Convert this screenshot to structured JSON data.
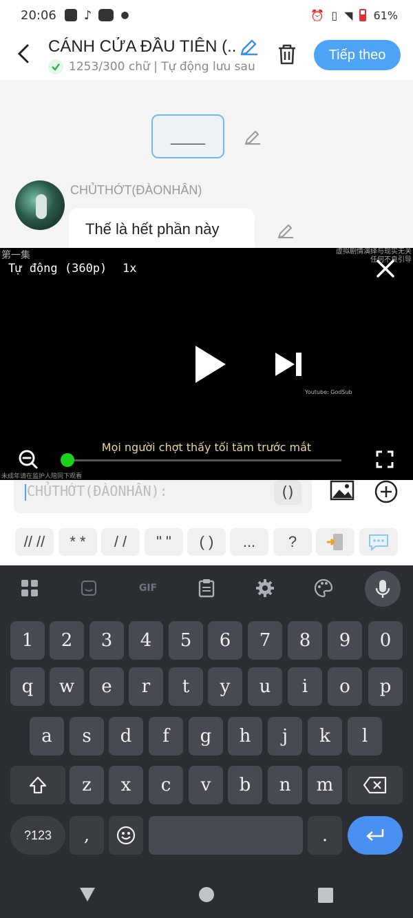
{
  "status_bar": {
    "time": "20:06",
    "battery": "61%"
  },
  "header": {
    "title": "CÁNH CỬA ĐẦU TIÊN (...",
    "subtitle": "1253/300 chữ | Tự động lưu sau",
    "next_label": "Tiếp theo"
  },
  "content": {
    "blank_box": "_____",
    "speaker": "CHỦTHỚT(ĐÀONHÂN)",
    "message": "Thế là hết phần này"
  },
  "video": {
    "episode": "第一集",
    "quality": "Tự động (360p)",
    "speed": "1x",
    "disclaimer": "虚拟剧情演绎与现实无关 任何不良引导",
    "credit": "Youtube: GodSub",
    "subtitle": "Mọi người chợt thấy tối tăm trước mắt",
    "footer": "未成年请在监护人陪同下观看",
    "progress": 0.0
  },
  "input": {
    "placeholder": "CHỦTHỚT(ĐÀONHÂN):",
    "paren": "()"
  },
  "quick_symbols": [
    "// //",
    "* *",
    "/ /",
    "\" \"",
    "( )",
    "...",
    "?"
  ],
  "keyboard": {
    "row_numbers": [
      "1",
      "2",
      "3",
      "4",
      "5",
      "6",
      "7",
      "8",
      "9",
      "0"
    ],
    "row1": [
      "q",
      "w",
      "e",
      "r",
      "t",
      "y",
      "u",
      "i",
      "o",
      "p"
    ],
    "row2": [
      "a",
      "s",
      "d",
      "f",
      "g",
      "h",
      "j",
      "k",
      "l"
    ],
    "row3": [
      "z",
      "x",
      "c",
      "v",
      "b",
      "n",
      "m"
    ],
    "sym_key": "?123",
    "comma": ",",
    "period": ".",
    "gif_label": "GIF"
  },
  "colors": {
    "accent": "#4da3f5",
    "video_knob": "#1ed11e",
    "keyboard_bg": "#2a2e32",
    "key_bg": "#474b51"
  }
}
